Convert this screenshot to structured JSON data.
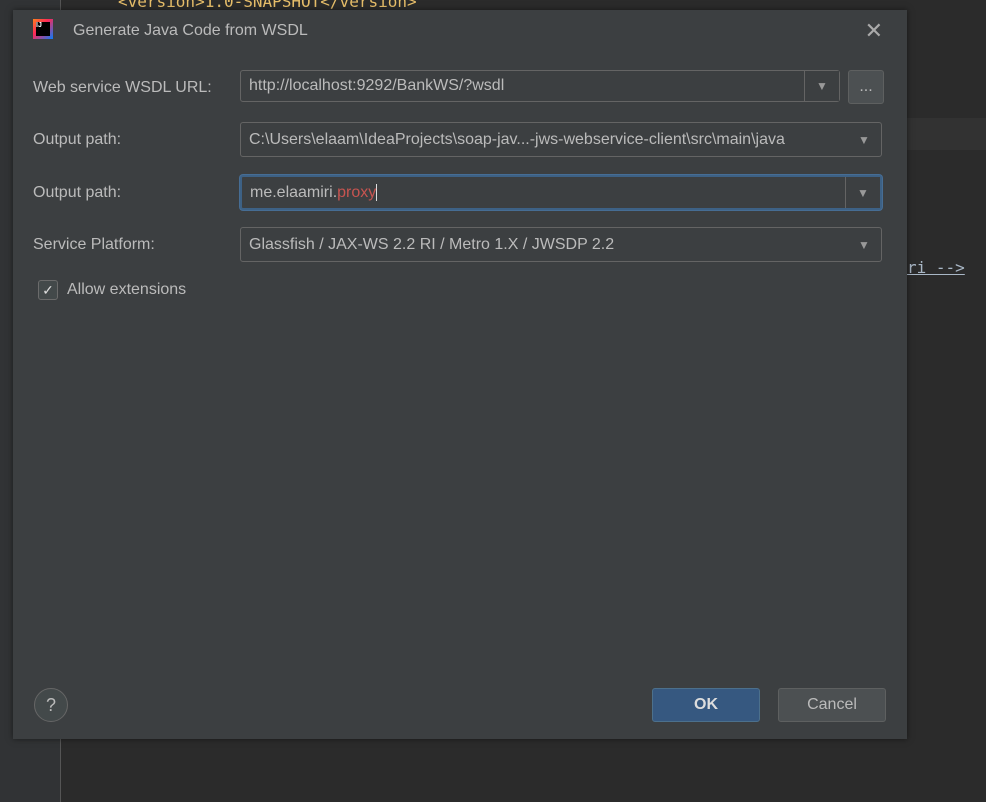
{
  "background_code": {
    "line1": "<version>1.0-SNAPSHOT</version>",
    "line2": "ri -->"
  },
  "dialog": {
    "title": "Generate Java Code from WSDL",
    "wsdl_url": {
      "label": "Web service WSDL URL:",
      "value": "http://localhost:9292/BankWS/?wsdl",
      "browse_label": "..."
    },
    "output_path": {
      "label": "Output path:",
      "value": "C:\\Users\\elaam\\IdeaProjects\\soap-jav...-jws-webservice-client\\src\\main\\java"
    },
    "package": {
      "label": "Output path:",
      "value_prefix": "me.elaamiri.",
      "value_error": "proxy"
    },
    "platform": {
      "label": "Service Platform:",
      "value": "Glassfish / JAX-WS 2.2 RI / Metro 1.X / JWSDP 2.2"
    },
    "allow_extensions": {
      "label": "Allow extensions",
      "checked": true
    },
    "help_label": "?",
    "ok_label": "OK",
    "cancel_label": "Cancel",
    "colors": {
      "error_text": "#c75450",
      "focus": "#3d6185",
      "ok_bg": "#365880"
    }
  }
}
